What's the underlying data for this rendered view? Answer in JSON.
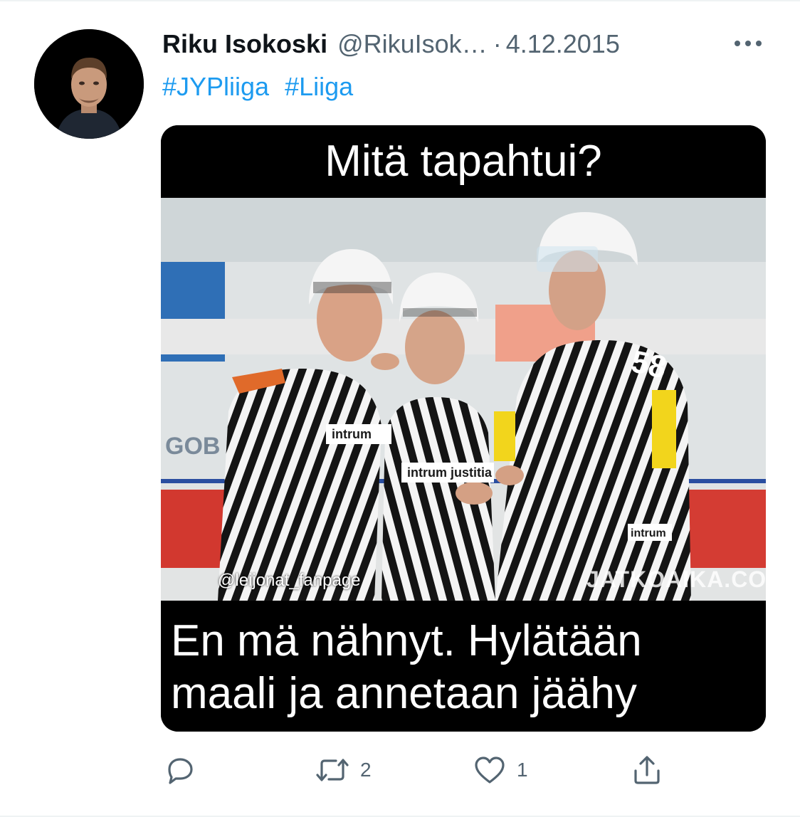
{
  "tweet": {
    "author_name": "Riku Isokoski",
    "author_handle": "@RikuIsok…",
    "separator": "·",
    "date": "4.12.2015",
    "hashtags": [
      "#JYPliiga",
      "#Liiga"
    ]
  },
  "media": {
    "top_caption": "Mitä tapahtui?",
    "bottom_caption_line1": "En mä nähnyt. Hylätään",
    "bottom_caption_line2": "maali ja annetaan jäähy",
    "watermark_left": "@leijonat_fanpage",
    "watermark_right": "JATKOAIKA.COM",
    "helmet_text": "intrum",
    "sleeve_text": "intrum justitia",
    "jersey_number": "58"
  },
  "actions": {
    "reply_icon": "reply-icon",
    "retweet_icon": "retweet-icon",
    "retweet_count": "2",
    "like_icon": "heart-icon",
    "like_count": "1",
    "share_icon": "share-icon"
  },
  "colors": {
    "link": "#1d9bf0",
    "secondary_text": "#536471",
    "primary_text": "#0f1419"
  }
}
